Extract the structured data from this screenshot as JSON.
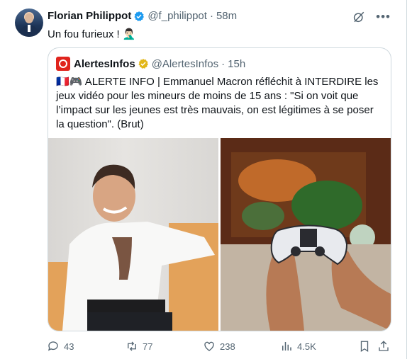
{
  "tweet": {
    "author_name": "Florian Philippot",
    "handle": "@f_philippot",
    "separator": "·",
    "time": "58m",
    "text": "Un fou furieux ! 🤦🏻‍♂️"
  },
  "quoted": {
    "author_name": "AlertesInfos",
    "handle": "@AlertesInfos",
    "separator": "·",
    "time": "15h",
    "text": "🇫🇷🎮 ALERTE INFO | Emmanuel Macron réfléchit à INTERDIRE les jeux vidéo pour les mineurs de moins de 15 ans : \"Si on voit que l’impact sur les jeunes est très mauvais, on est légitimes à se poser la question\". (Brut)"
  },
  "actions": {
    "replies": "43",
    "reposts": "77",
    "likes": "238",
    "views": "4.5K"
  },
  "colors": {
    "verified_blue": "#1d9bf0",
    "verified_gold": "#e2b719",
    "muted": "#536471",
    "border": "#cfd9de",
    "alertes_red": "#e0241d"
  },
  "icons": [
    "verified-badge-icon",
    "grok-icon",
    "more-icon",
    "reply-icon",
    "repost-icon",
    "like-icon",
    "views-icon",
    "bookmark-icon",
    "share-icon"
  ]
}
